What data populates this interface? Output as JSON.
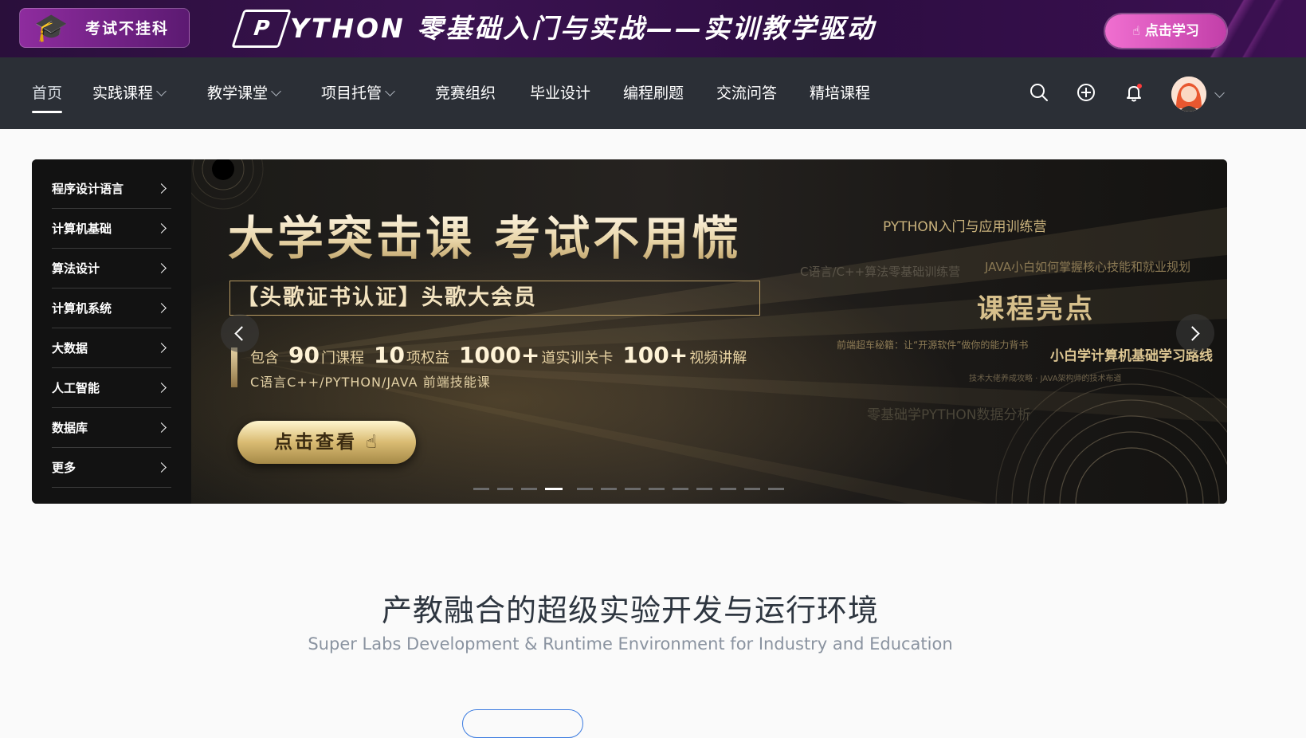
{
  "promo": {
    "badge": "考试不挂科",
    "logo_letter": "P",
    "headline": "YTHON 零基础入门与实战——实训教学驱动",
    "cta": "点击学习"
  },
  "nav": {
    "items": [
      {
        "label": "首页",
        "active": true
      },
      {
        "label": "实践课程",
        "dropdown": true
      },
      {
        "label": "教学课堂",
        "dropdown": true
      },
      {
        "label": "项目托管",
        "dropdown": true
      },
      {
        "label": "竞赛组织"
      },
      {
        "label": "毕业设计"
      },
      {
        "label": "编程刷题"
      },
      {
        "label": "交流问答"
      },
      {
        "label": "精培课程"
      }
    ],
    "icons": [
      "search-icon",
      "add-icon",
      "notification-bell-icon"
    ]
  },
  "sidebar": {
    "items": [
      {
        "label": "程序设计语言"
      },
      {
        "label": "计算机基础"
      },
      {
        "label": "算法设计"
      },
      {
        "label": "计算机系统"
      },
      {
        "label": "大数据"
      },
      {
        "label": "人工智能"
      },
      {
        "label": "数据库"
      },
      {
        "label": "更多"
      }
    ]
  },
  "banner": {
    "title": "大学突击课 考试不用慌",
    "box_text": "【头歌证书认证】头歌大会员",
    "stats": {
      "prefix": "包含",
      "n1": "90",
      "t1": "门课程",
      "n2": "10",
      "t2": "项权益",
      "n3": "1000+",
      "t3": "道实训关卡",
      "n4": "100+",
      "t4": "视频讲解"
    },
    "tech": "C语言C++/PYTHON/JAVA  前端技能课",
    "cta": "点击查看",
    "right": {
      "r1": "PYTHON入门与应用训练营",
      "r2": "C语言/C++算法零基础训练营",
      "r3": "JAVA小白如何掌握核心技能和就业规划",
      "r4": "课程亮点",
      "r5": "前端超车秘籍：让“开源软件”做你的能力背书",
      "r6": "小白学计算机基础学习路线",
      "r7": "技术大佬养成攻略 · JAVA架构师的技术布道",
      "r8": "零基础学PYTHON数据分析"
    },
    "dots_total": 13,
    "dots_active": 3
  },
  "section": {
    "title": "产教融合的超级实验开发与运行环境",
    "subtitle": "Super Labs Development & Runtime Environment for Industry and Education"
  },
  "colors": {
    "nav_bg": "#2b2f36",
    "promo_bg": "#2d0d42",
    "promo_cta": "#e05bc4",
    "banner_gold": "#d9bb72",
    "page_bg": "#fafafa"
  }
}
